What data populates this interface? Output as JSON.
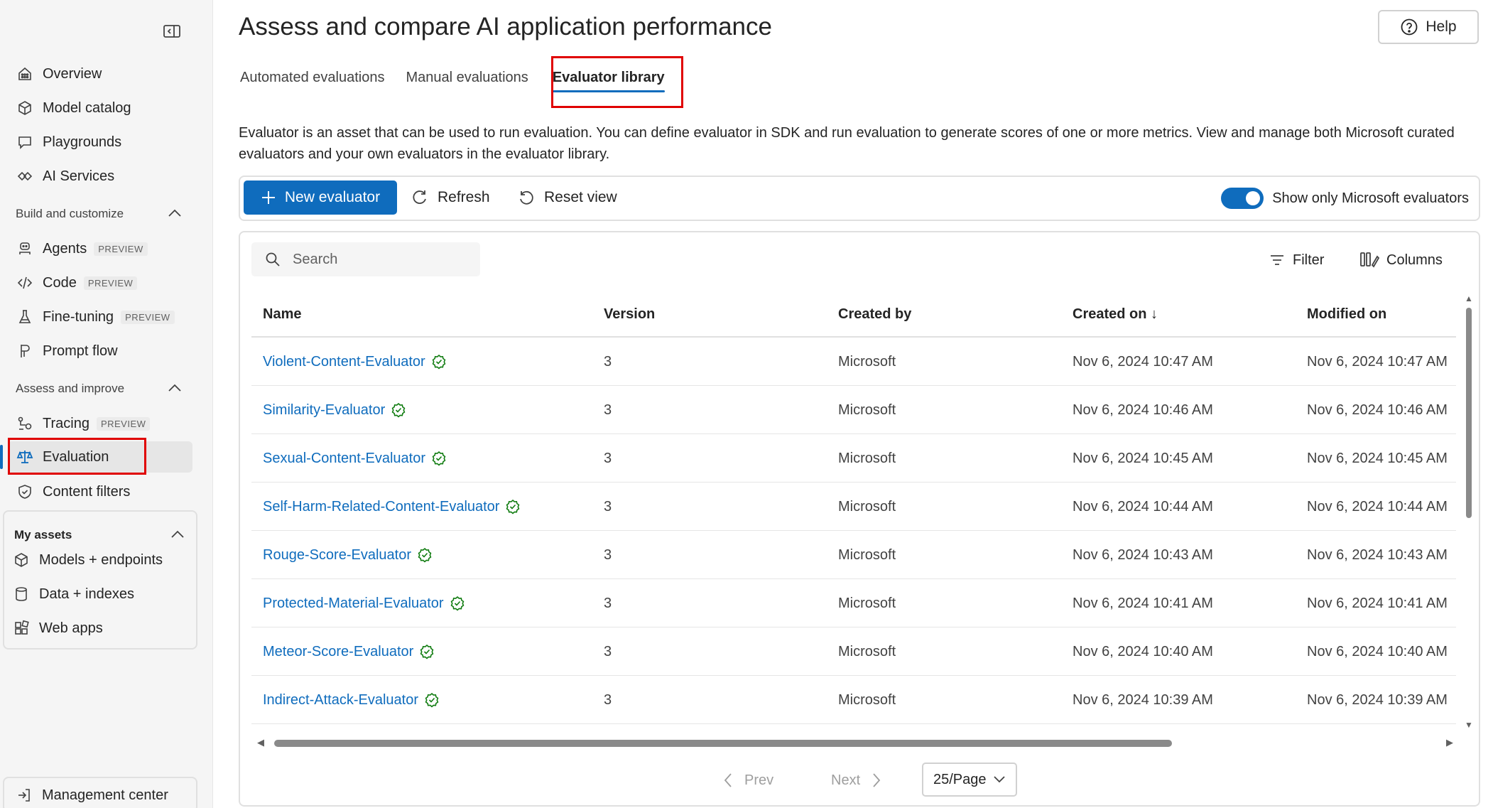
{
  "sidebar": {
    "items_top": [
      {
        "label": "Overview",
        "icon": "overview-icon"
      },
      {
        "label": "Model catalog",
        "icon": "cube-icon"
      },
      {
        "label": "Playgrounds",
        "icon": "chat-icon"
      },
      {
        "label": "AI Services",
        "icon": "services-icon"
      }
    ],
    "build": {
      "title": "Build and customize",
      "items": [
        {
          "label": "Agents",
          "badge": "PREVIEW"
        },
        {
          "label": "Code",
          "badge": "PREVIEW"
        },
        {
          "label": "Fine-tuning",
          "badge": "PREVIEW"
        },
        {
          "label": "Prompt flow"
        }
      ]
    },
    "assess": {
      "title": "Assess and improve",
      "items": [
        {
          "label": "Tracing",
          "badge": "PREVIEW"
        },
        {
          "label": "Evaluation"
        },
        {
          "label": "Content filters"
        }
      ]
    },
    "assets": {
      "title": "My assets",
      "items": [
        {
          "label": "Models + endpoints"
        },
        {
          "label": "Data + indexes"
        },
        {
          "label": "Web apps"
        }
      ]
    },
    "management": {
      "label": "Management center"
    }
  },
  "header": {
    "title": "Assess and compare AI application performance",
    "help_label": "Help"
  },
  "tabs": [
    {
      "label": "Automated evaluations"
    },
    {
      "label": "Manual evaluations"
    },
    {
      "label": "Evaluator library"
    }
  ],
  "description": "Evaluator is an asset that can be used to run evaluation. You can define evaluator in SDK and run evaluation to generate scores of one or more metrics. View and manage both Microsoft curated evaluators and your own evaluators in the evaluator library.",
  "toolbar": {
    "new_label": "New evaluator",
    "refresh_label": "Refresh",
    "reset_label": "Reset view",
    "toggle_label": "Show only Microsoft evaluators",
    "toggle_on": true
  },
  "table": {
    "search_placeholder": "Search",
    "filter_label": "Filter",
    "columns_label": "Columns",
    "headers": [
      "Name",
      "Version",
      "Created by",
      "Created on ↓",
      "Modified on"
    ],
    "rows": [
      {
        "name": "Violent-Content-Evaluator",
        "version": "3",
        "created_by": "Microsoft",
        "created_on": "Nov 6, 2024 10:47 AM",
        "modified_on": "Nov 6, 2024 10:47 AM"
      },
      {
        "name": "Similarity-Evaluator",
        "version": "3",
        "created_by": "Microsoft",
        "created_on": "Nov 6, 2024 10:46 AM",
        "modified_on": "Nov 6, 2024 10:46 AM"
      },
      {
        "name": "Sexual-Content-Evaluator",
        "version": "3",
        "created_by": "Microsoft",
        "created_on": "Nov 6, 2024 10:45 AM",
        "modified_on": "Nov 6, 2024 10:45 AM"
      },
      {
        "name": "Self-Harm-Related-Content-Evaluator",
        "version": "3",
        "created_by": "Microsoft",
        "created_on": "Nov 6, 2024 10:44 AM",
        "modified_on": "Nov 6, 2024 10:44 AM"
      },
      {
        "name": "Rouge-Score-Evaluator",
        "version": "3",
        "created_by": "Microsoft",
        "created_on": "Nov 6, 2024 10:43 AM",
        "modified_on": "Nov 6, 2024 10:43 AM"
      },
      {
        "name": "Protected-Material-Evaluator",
        "version": "3",
        "created_by": "Microsoft",
        "created_on": "Nov 6, 2024 10:41 AM",
        "modified_on": "Nov 6, 2024 10:41 AM"
      },
      {
        "name": "Meteor-Score-Evaluator",
        "version": "3",
        "created_by": "Microsoft",
        "created_on": "Nov 6, 2024 10:40 AM",
        "modified_on": "Nov 6, 2024 10:40 AM"
      },
      {
        "name": "Indirect-Attack-Evaluator",
        "version": "3",
        "created_by": "Microsoft",
        "created_on": "Nov 6, 2024 10:39 AM",
        "modified_on": "Nov 6, 2024 10:39 AM"
      }
    ]
  },
  "pager": {
    "prev_label": "Prev",
    "next_label": "Next",
    "page_size": "25/Page"
  },
  "colors": {
    "accent": "#0f6cbd",
    "highlight_box": "#e00000"
  }
}
